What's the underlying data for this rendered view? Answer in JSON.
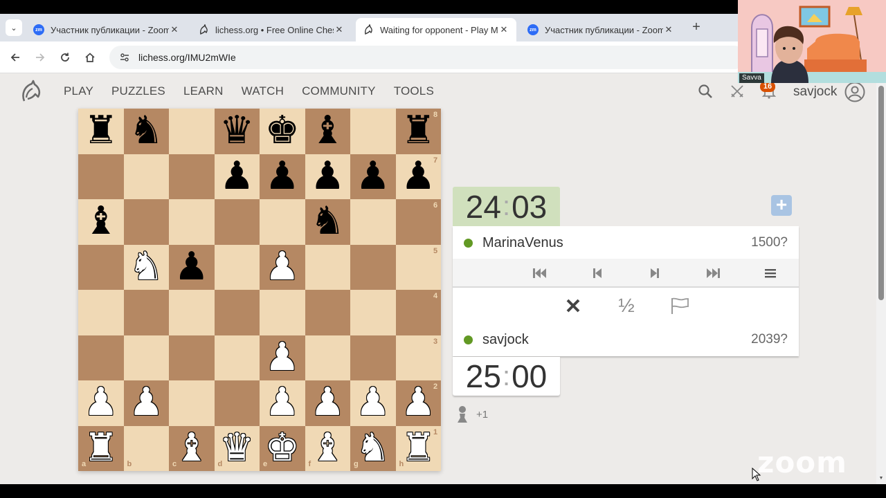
{
  "browser": {
    "tabs": [
      {
        "title": "Участник публикации - Zoom",
        "icon": "zoom-icon",
        "active": false
      },
      {
        "title": "lichess.org • Free Online Chess",
        "icon": "lichess-icon",
        "active": false
      },
      {
        "title": "Waiting for opponent - Play Ma",
        "icon": "lichess-icon",
        "active": true
      },
      {
        "title": "Участник публикации - Zoom",
        "icon": "zoom-icon",
        "active": false
      }
    ],
    "url": "lichess.org/IMU2mWIe",
    "zm_label": "zm"
  },
  "zoom": {
    "participant_name": "Savva",
    "watermark": "zoom"
  },
  "lichess": {
    "nav": [
      "PLAY",
      "PUZZLES",
      "LEARN",
      "WATCH",
      "COMMUNITY",
      "TOOLS"
    ],
    "notification_count": "16",
    "username": "savjock"
  },
  "board": {
    "rows": [
      "rn.qkb.r",
      "...ppppp",
      "b....n..",
      ".Np.P...",
      "........",
      "....P...",
      "PP..PPPP",
      "R.BQKBNR"
    ],
    "ranks": [
      "8",
      "7",
      "6",
      "5",
      "4",
      "3",
      "2",
      "1"
    ],
    "files": [
      "a",
      "b",
      "c",
      "d",
      "e",
      "f",
      "g",
      "h"
    ]
  },
  "game": {
    "top_clock": {
      "min": "24",
      "sec": "03"
    },
    "bottom_clock": {
      "min": "25",
      "sec": "00"
    },
    "opponent": {
      "name": "MarinaVenus",
      "rating": "1500?"
    },
    "player": {
      "name": "savjock",
      "rating": "2039?"
    },
    "draw_label": "½",
    "spectators": "+1"
  },
  "colors": {
    "light_square": "#f0d9b5",
    "dark_square": "#b58863",
    "online_dot": "#629924",
    "active_clock": "#d0e0bd",
    "badge": "#d85000"
  }
}
